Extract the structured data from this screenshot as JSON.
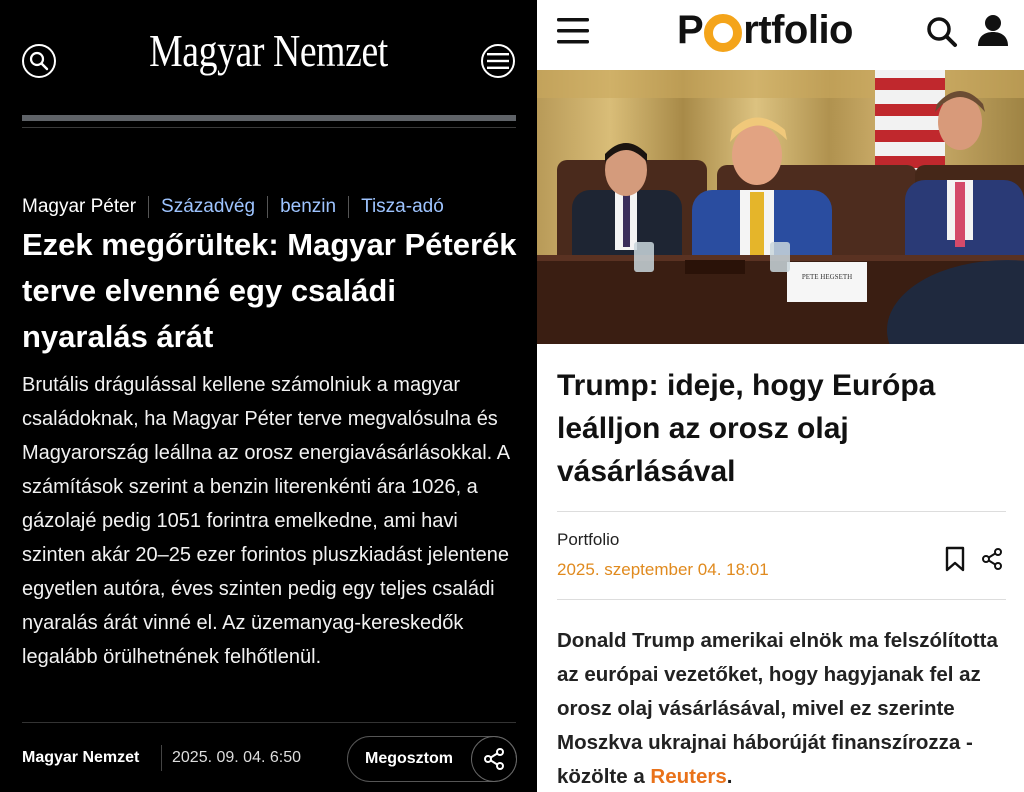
{
  "left": {
    "brand": "Magyar Nemzet",
    "tags": {
      "main": "Magyar Péter",
      "links": [
        "Századvég",
        "benzin",
        "Tisza-adó"
      ]
    },
    "headline": "Ezek megőrültek: Magyar Pé­terék terve elvenné egy családi nyaralás árát",
    "lead": "Brutális drágulással kellene számolniuk a magyar családoknak, ha Magyar Péter terve megvalósulna és Magyarország leállna az orosz energiavásárlá­sokkal. A számítások szerint a benzin literenkénti ára 1026, a gázolajé pedig 1051 forintra emel­kedne, ami havi szinten akár 20–25 ezer forintos pluszkiadást jelentene egyetlen autóra, éves szin­ten pedig egy teljes családi nyaralás árát vinné el. Az üzemanyag-kereskedők legalább örülhetnének felhőtlenül.",
    "footer": {
      "source": "Magyar Nemzet",
      "date": "2025. 09. 04. 6:50",
      "share_label": "Megosztom"
    },
    "icons": {
      "search": "search-icon",
      "menu": "menu-icon",
      "share": "share-icon"
    },
    "colors": {
      "background": "#000000",
      "tag_link": "#9ec4ff"
    }
  },
  "right": {
    "brand": {
      "before": "P",
      "after": "rtfolio"
    },
    "headline": "Trump: ideje, hogy Európa leálljon az orosz olaj vásárlásával",
    "author": "Portfolio",
    "date": "2025. szeptember 04. 18:01",
    "lead_main": "Donald Trump amerikai elnök ma felszólította az európai vezetőket, hogy hagyjanak fel az orosz olaj vásárlásával, mivel ez szerinte Moszkva ukrajnai háborúját finanszírozza - közölte a ",
    "lead_link": "Reuters",
    "lead_end": ".",
    "placard_text": "PETE HEGSETH",
    "icons": {
      "menu": "hamburger-icon",
      "search": "search-icon",
      "user": "user-icon",
      "bookmark": "bookmark-icon",
      "share": "share-icon"
    },
    "colors": {
      "accent": "#f4a41a",
      "date": "#e08a1e",
      "link": "#e9721a"
    }
  }
}
